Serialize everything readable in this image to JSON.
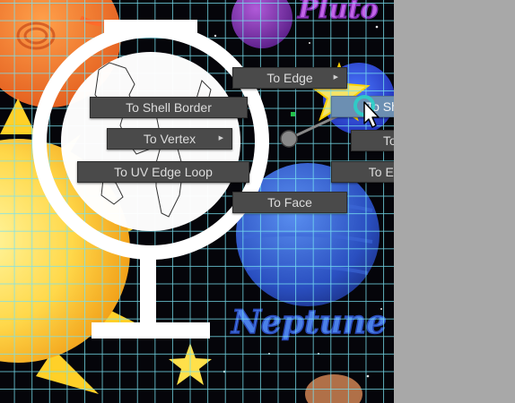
{
  "viewport": {
    "background_labels": {
      "pluto": "Pluto",
      "neptune": "Neptune"
    }
  },
  "marking_menu": {
    "to_edge": "To Edge",
    "to_shell_prefix": "To She",
    "to_shell_suffix": "ll",
    "to_shell_border": "To Shell Border",
    "to_vertex": "To Vertex",
    "to_uv": "To UV",
    "to_uv_edge_loop": "To UV Edge Loop",
    "to_edge_loop": "To Edge Loop",
    "to_face": "To Face",
    "submenu_arrow": "▶"
  },
  "colors": {
    "menu_bg": "#4a4a4a",
    "menu_active": "#6c8fb2",
    "grid": "#78e1f0",
    "side_panel": "#a8a8a8"
  }
}
